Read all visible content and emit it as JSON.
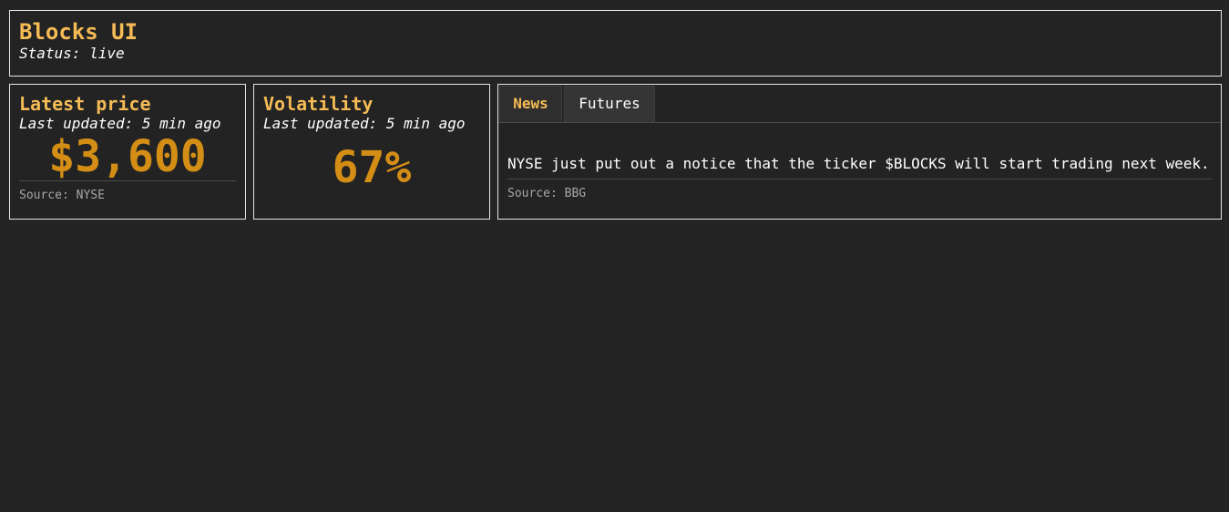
{
  "header": {
    "title": "Blocks UI",
    "status": "Status: live"
  },
  "price_card": {
    "title": "Latest price",
    "updated": "Last updated: 5 min ago",
    "value": "$3,600",
    "source": "Source: NYSE"
  },
  "volatility_card": {
    "title": "Volatility",
    "updated": "Last updated: 5 min ago",
    "value": "67%"
  },
  "tabs": {
    "items": [
      {
        "label": "News",
        "active": true
      },
      {
        "label": "Futures",
        "active": false
      }
    ],
    "news": {
      "text": "NYSE just put out a notice that the ticker $BLOCKS will start trading next week.",
      "source": "Source: BBG"
    }
  },
  "colors": {
    "background": "#242424",
    "accent": "#f5bb55",
    "value": "#d48e16",
    "border": "#e6e6e6"
  }
}
